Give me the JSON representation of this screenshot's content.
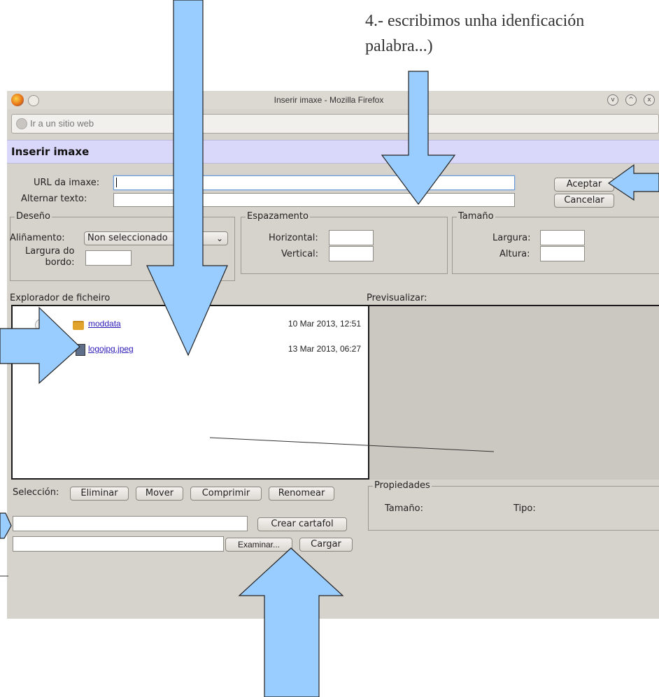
{
  "doc": {
    "line1": "4.- escribimos unha idenficación",
    "line2": "palabra...)"
  },
  "window": {
    "title": "Inserir imaxe - Mozilla Firefox",
    "url_placeholder": "Ir a un sitio web",
    "controls": [
      "v",
      "^",
      "x"
    ]
  },
  "dialog": {
    "title": "Inserir imaxe",
    "url_label": "URL da imaxe:",
    "url_value": "",
    "alt_label": "Alternar texto:",
    "alt_value": "",
    "accept_label": "Aceptar",
    "cancel_label": "Cancelar"
  },
  "design": {
    "legend": "Deseño",
    "align_label": "Aliñamento:",
    "align_value": "Non seleccionado",
    "border_label_1": "Largura do",
    "border_label_2": "bordo:"
  },
  "spacing": {
    "legend": "Espazamento",
    "horizontal_label": "Horizontal:",
    "vertical_label": "Vertical:"
  },
  "size": {
    "legend": "Tamaño",
    "width_label": "Largura:",
    "height_label": "Altura:"
  },
  "explorer": {
    "label": "Explorador de ficheiro",
    "preview_label": "Previsualizar:",
    "files": [
      {
        "name": "moddata",
        "date": "10 Mar 2013, 12:51",
        "type": "folder"
      },
      {
        "name": "logojpg.jpeg",
        "date": "13 Mar 2013, 06:27",
        "type": "file"
      }
    ]
  },
  "selection": {
    "label": "Selección:",
    "delete_label": "Eliminar",
    "move_label": "Mover",
    "zip_label": "Comprimir",
    "rename_label": "Renomear"
  },
  "properties": {
    "legend": "Propiedades",
    "size_label": "Tamaño:",
    "type_label": "Tipo:"
  },
  "actions": {
    "create_folder_label": "Crear cartafol",
    "browse_label": "Examinar...",
    "upload_label": "Cargar"
  },
  "colors": {
    "arrow_fill": "#99ccff",
    "header_bg": "#d9d8fb",
    "window_bg": "#d6d2cc"
  }
}
